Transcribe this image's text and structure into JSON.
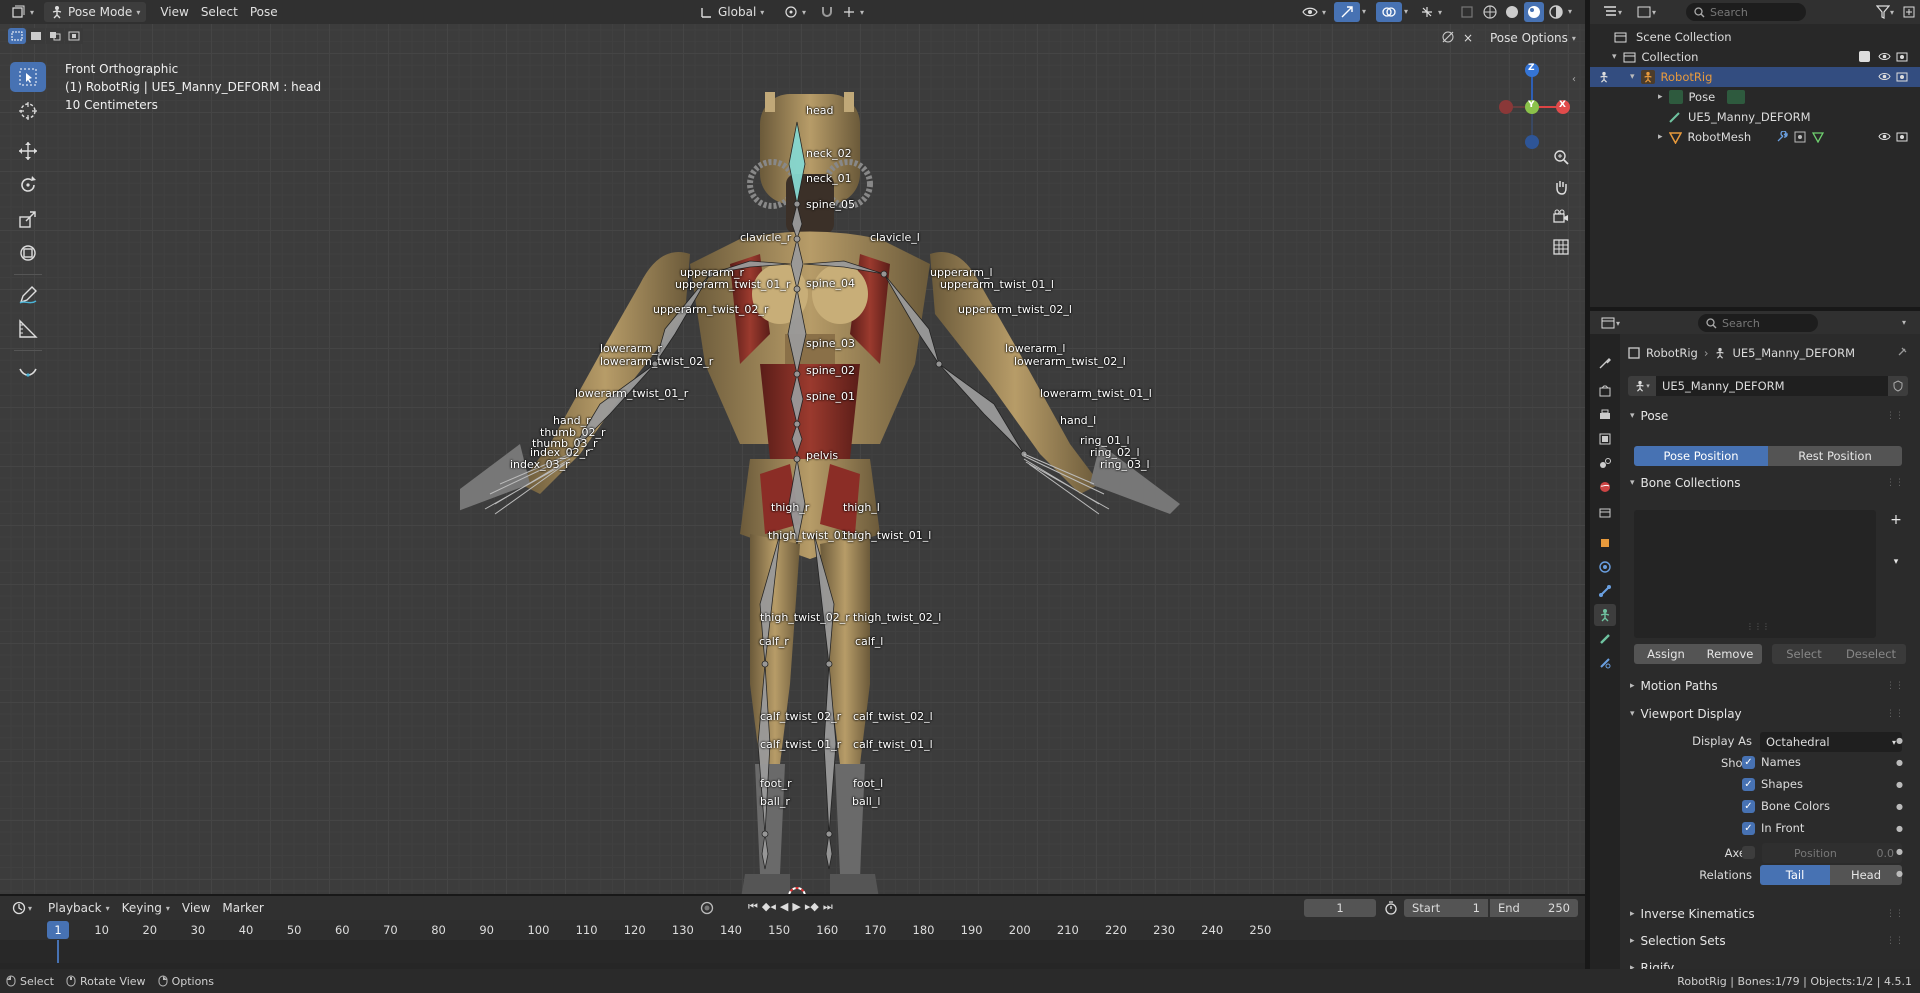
{
  "header": {
    "mode": "Pose Mode",
    "menus": [
      "View",
      "Select",
      "Pose"
    ],
    "transform_orientation": "Global",
    "pose_options": "Pose Options"
  },
  "viewport": {
    "view_name": "Front Orthographic",
    "active": "(1) RobotRig | UE5_Manny_DEFORM : head",
    "scale": "10 Centimeters",
    "gizmo": {
      "z": "Z",
      "y": "Y",
      "x": "X"
    },
    "bones": [
      {
        "name": "head"
      },
      {
        "name": "neck_02"
      },
      {
        "name": "neck_01"
      },
      {
        "name": "spine_05"
      },
      {
        "name": "clavicle_r"
      },
      {
        "name": "clavicle_l"
      },
      {
        "name": "upperarm_r"
      },
      {
        "name": "upperarm_twist_01_r"
      },
      {
        "name": "spine_04"
      },
      {
        "name": "upperarm_l"
      },
      {
        "name": "upperarm_twist_01_l"
      },
      {
        "name": "upperarm_twist_02_r"
      },
      {
        "name": "upperarm_twist_02_l"
      },
      {
        "name": "spine_03"
      },
      {
        "name": "lowerarm_r"
      },
      {
        "name": "lowerarm_twist_02_r"
      },
      {
        "name": "lowerarm_l"
      },
      {
        "name": "lowerarm_twist_02_l"
      },
      {
        "name": "spine_02"
      },
      {
        "name": "lowerarm_twist_01_r"
      },
      {
        "name": "spine_01"
      },
      {
        "name": "lowerarm_twist_01_l"
      },
      {
        "name": "hand_r"
      },
      {
        "name": "hand_l"
      },
      {
        "name": "pelvis"
      },
      {
        "name": "thigh_r"
      },
      {
        "name": "thigh_l"
      },
      {
        "name": "thigh_twist_01_r"
      },
      {
        "name": "thigh_twist_01_l"
      },
      {
        "name": "thigh_twist_02_r"
      },
      {
        "name": "thigh_twist_02_l"
      },
      {
        "name": "calf_r"
      },
      {
        "name": "calf_l"
      },
      {
        "name": "calf_twist_02_r"
      },
      {
        "name": "calf_twist_02_l"
      },
      {
        "name": "calf_twist_01_r"
      },
      {
        "name": "calf_twist_01_l"
      },
      {
        "name": "foot_r"
      },
      {
        "name": "foot_l"
      },
      {
        "name": "ball_r"
      },
      {
        "name": "ball_l"
      },
      {
        "name": "thumb_02_r"
      },
      {
        "name": "thumb_03_r"
      },
      {
        "name": "index_02_r"
      },
      {
        "name": "index_03_r"
      },
      {
        "name": "ring_01_l"
      },
      {
        "name": "ring_02_l"
      },
      {
        "name": "ring_03_l"
      }
    ]
  },
  "outliner": {
    "search_placeholder": "Search",
    "rows": [
      {
        "label": "Scene Collection"
      },
      {
        "label": "Collection"
      },
      {
        "label": "RobotRig"
      },
      {
        "label": "Pose"
      },
      {
        "label": "UE5_Manny_DEFORM"
      },
      {
        "label": "RobotMesh"
      }
    ]
  },
  "properties": {
    "search_placeholder": "Search",
    "breadcrumb_object": "RobotRig",
    "breadcrumb_data": "UE5_Manny_DEFORM",
    "datablock_name": "UE5_Manny_DEFORM",
    "pose_panel": "Pose",
    "pose_position": "Pose Position",
    "rest_position": "Rest Position",
    "bone_collections_panel": "Bone Collections",
    "assign": "Assign",
    "remove": "Remove",
    "select": "Select",
    "deselect": "Deselect",
    "motion_paths": "Motion Paths",
    "viewport_display": "Viewport Display",
    "display_as_label": "Display As",
    "display_as_value": "Octahedral",
    "show_label": "Show",
    "show_names": "Names",
    "show_shapes": "Shapes",
    "show_bone_colors": "Bone Colors",
    "show_in_front": "In Front",
    "axes_label": "Axes",
    "axes_position_label": "Position",
    "axes_position_value": "0.0",
    "relations_label": "Relations",
    "relations_tail": "Tail",
    "relations_head": "Head",
    "inverse_kinematics": "Inverse Kinematics",
    "selection_sets": "Selection Sets",
    "rigify": "Rigify"
  },
  "timeline": {
    "menus": [
      "Playback",
      "Keying",
      "View",
      "Marker"
    ],
    "current_frame": "1",
    "start_label": "Start",
    "start": "1",
    "end_label": "End",
    "end": "250",
    "ticks": [
      "10",
      "20",
      "30",
      "40",
      "50",
      "60",
      "70",
      "80",
      "90",
      "100",
      "110",
      "120",
      "130",
      "140",
      "150",
      "160",
      "170",
      "180",
      "190",
      "200",
      "210",
      "220",
      "230",
      "240",
      "250"
    ],
    "playhead": "1"
  },
  "statusbar": {
    "select": "Select",
    "rotate": "Rotate View",
    "options": "Options",
    "stats": "RobotRig | Bones:1/79 | Objects:1/2 | 4.5.1"
  },
  "colors": {
    "accent": "#4772b3",
    "active_object": "#e89a3c",
    "header": "#303030"
  }
}
